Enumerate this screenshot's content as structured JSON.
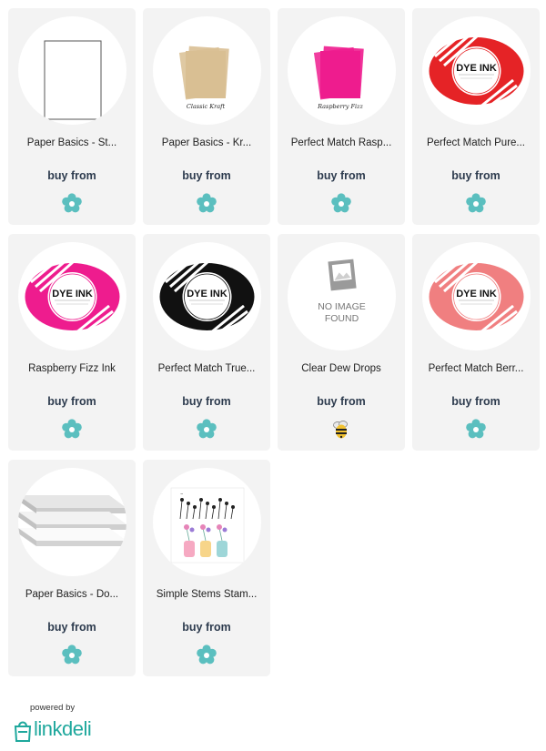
{
  "products": [
    {
      "title": "Paper Basics - St...",
      "buy_label": "buy from",
      "image": "white-cardstock",
      "store_icon": "flower-store-icon"
    },
    {
      "title": "Paper Basics - Kr...",
      "buy_label": "buy from",
      "image": "kraft-cardstock",
      "image_caption": "Classic Kraft",
      "store_icon": "flower-store-icon"
    },
    {
      "title": "Perfect Match Rasp...",
      "buy_label": "buy from",
      "image": "raspberry-cardstock",
      "image_caption": "Raspberry Fizz",
      "store_icon": "flower-store-icon"
    },
    {
      "title": "Perfect Match Pure...",
      "buy_label": "buy from",
      "image": "red-ink-pad",
      "image_caption": "DYE INK",
      "store_icon": "flower-store-icon"
    },
    {
      "title": "Raspberry Fizz Ink",
      "buy_label": "buy from",
      "image": "raspberry-ink-pad",
      "image_caption": "DYE INK",
      "store_icon": "flower-store-icon"
    },
    {
      "title": "Perfect Match True...",
      "buy_label": "buy from",
      "image": "black-ink-pad",
      "image_caption": "DYE INK",
      "store_icon": "flower-store-icon"
    },
    {
      "title": "Clear Dew Drops",
      "buy_label": "buy from",
      "image": "no-image-placeholder",
      "image_caption": "NO IMAGE FOUND",
      "store_icon": "bee-store-icon"
    },
    {
      "title": "Perfect Match Berr...",
      "buy_label": "buy from",
      "image": "pink-ink-pad",
      "image_caption": "DYE INK",
      "store_icon": "flower-store-icon"
    },
    {
      "title": "Paper Basics - Do...",
      "buy_label": "buy from",
      "image": "foam-board-stack",
      "store_icon": "flower-store-icon"
    },
    {
      "title": "Simple Stems Stam...",
      "buy_label": "buy from",
      "image": "stamp-set",
      "store_icon": "flower-store-icon"
    }
  ],
  "footer": {
    "powered_by": "powered by",
    "brand": "linkdeli"
  },
  "colors": {
    "card_bg": "#f3f3f3",
    "buy_text": "#2d3b4e",
    "store_teal": "#5bbfbf",
    "brand_teal": "#1fa89d",
    "kraft": "#d9bf93",
    "raspberry": "#ee1c8e",
    "red_ink": "#e52326",
    "black_ink": "#111111",
    "pink_ink": "#f07f80"
  }
}
